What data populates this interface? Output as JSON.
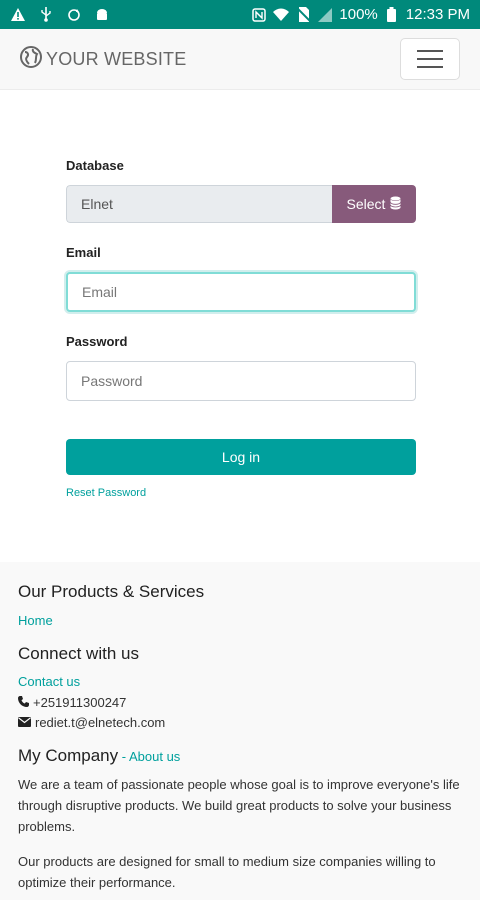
{
  "status_bar": {
    "battery": "100%",
    "time": "12:33 PM",
    "left_icons": [
      "warning-icon",
      "usb-icon",
      "sync-icon",
      "android-icon"
    ],
    "right_icons": [
      "nfc-icon",
      "wifi-icon",
      "no-sim-icon",
      "signal-icon",
      "battery-icon"
    ]
  },
  "navbar": {
    "brand": "YOUR WEBSITE"
  },
  "login": {
    "database_label": "Database",
    "database_value": "Elnet",
    "select_label": "Select",
    "email_label": "Email",
    "email_placeholder": "Email",
    "password_label": "Password",
    "password_placeholder": "Password",
    "login_button": "Log in",
    "reset_password": "Reset Password"
  },
  "footer": {
    "products_heading": "Our Products & Services",
    "home_link": "Home",
    "connect_heading": "Connect with us",
    "contact_link": "Contact us",
    "phone": "+251911300247",
    "email": "rediet.t@elnetech.com",
    "company_heading": "My Company",
    "company_separator": " - ",
    "about_link": "About us",
    "paragraph1": "We are a team of passionate people whose goal is to improve everyone's life through disruptive products. We build great products to solve your business problems.",
    "paragraph2": "Our products are designed for small to medium size companies willing to optimize their performance."
  },
  "colors": {
    "status_bar": "#00897b",
    "primary": "#00a09d",
    "select_button": "#875a7b"
  }
}
